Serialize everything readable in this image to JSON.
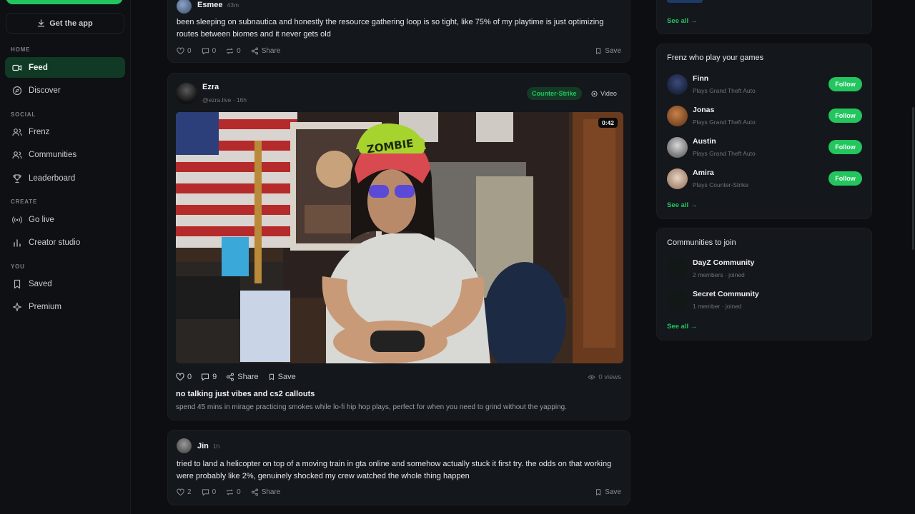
{
  "sidebar": {
    "get_app": "Get the app",
    "sections": {
      "home": "HOME",
      "social": "SOCIAL",
      "create": "CREATE",
      "you": "YOU"
    },
    "items": {
      "feed": "Feed",
      "discover": "Discover",
      "frenz": "Frenz",
      "communities": "Communities",
      "leaderboard": "Leaderboard",
      "go_live": "Go live",
      "creator_studio": "Creator studio",
      "saved": "Saved",
      "premium": "Premium"
    }
  },
  "posts": [
    {
      "user": "Esmee",
      "time": "43m",
      "text": "been sleeping on subnautica and honestly the resource gathering loop is so tight, like 75% of my playtime is just optimizing routes between biomes and it never gets old",
      "likes": "0",
      "comments": "0",
      "reposts": "0",
      "share": "Share",
      "save": "Save"
    },
    {
      "user": "Ezra",
      "handle": "@ezra.live · 16h",
      "game_tag": "Counter-Strike",
      "type_tag": "Video",
      "duration": "0:42",
      "likes": "0",
      "comments": "9",
      "share": "Share",
      "save": "Save",
      "views": "0 views",
      "title": "no talking just vibes and cs2 callouts",
      "desc": "spend 45 mins in mirage practicing smokes while lo-fi hip hop plays, perfect for when you need to grind without the yapping."
    },
    {
      "user": "Jin",
      "time": "1h",
      "text": "tried to land a helicopter on top of a moving train in gta online and somehow actually stuck it first try. the odds on that working were probably like 2%, genuinely shocked my crew watched the whole thing happen",
      "likes": "2",
      "comments": "0",
      "reposts": "0",
      "share": "Share",
      "save": "Save"
    }
  ],
  "right": {
    "top_see_all": "See all →",
    "frenz": {
      "title": "Frenz who play your games",
      "people": [
        {
          "name": "Finn",
          "sub": "Plays Grand Theft Auto",
          "btn": "Follow"
        },
        {
          "name": "Jonas",
          "sub": "Plays Grand Theft Auto",
          "btn": "Follow"
        },
        {
          "name": "Austin",
          "sub": "Plays Grand Theft Auto",
          "btn": "Follow"
        },
        {
          "name": "Amira",
          "sub": "Plays Counter-Strike",
          "btn": "Follow"
        }
      ],
      "see_all": "See all →"
    },
    "communities": {
      "title": "Communities to join",
      "items": [
        {
          "name": "DayZ Community",
          "sub": "2 members · joined"
        },
        {
          "name": "Secret Community",
          "sub": "1 member · joined"
        }
      ],
      "see_all": "See all →"
    }
  },
  "colors": {
    "accent": "#22c55e",
    "background": "#0c0e11",
    "card": "#14171b"
  }
}
